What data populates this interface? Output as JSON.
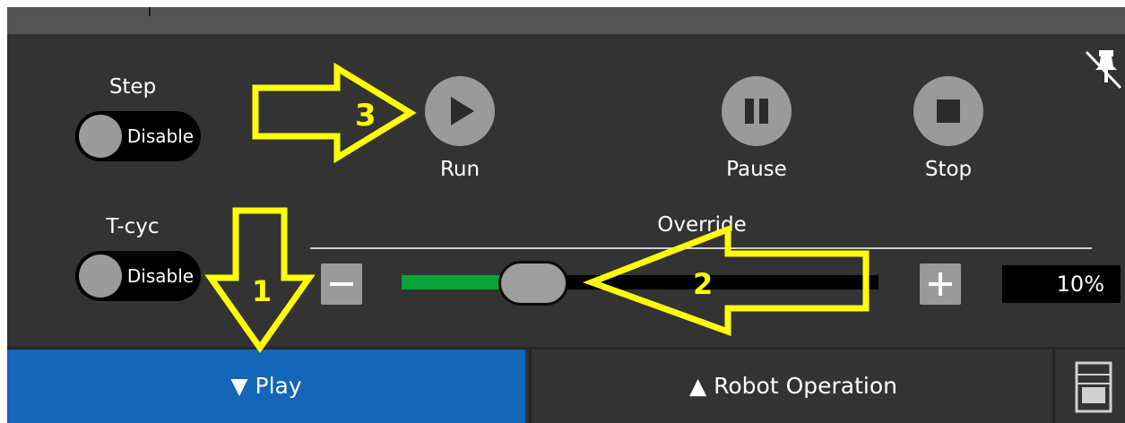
{
  "step": {
    "label": "Step",
    "toggle_text": "Disable"
  },
  "tcyc": {
    "label": "T-cyc",
    "toggle_text": "Disable"
  },
  "controls": {
    "run_label": "Run",
    "pause_label": "Pause",
    "stop_label": "Stop"
  },
  "override": {
    "label": "Override",
    "value_text": "10%",
    "level_percent": 10
  },
  "tabs": {
    "play_label": "▼ Play",
    "robot_label": "▲ Robot Operation"
  },
  "annotations": {
    "arrow1": "1",
    "arrow2": "2",
    "arrow3": "3"
  },
  "colors": {
    "panel": "#333333",
    "play_tab": "#1565b8",
    "slider_fill": "#0aa53a",
    "annotation": "#ffff00"
  },
  "icons": {
    "pin": "unpin-icon",
    "run": "play-icon",
    "pause": "pause-icon",
    "stop": "stop-icon",
    "minus": "minus-icon",
    "plus": "plus-icon",
    "panel": "monitor-icon"
  }
}
